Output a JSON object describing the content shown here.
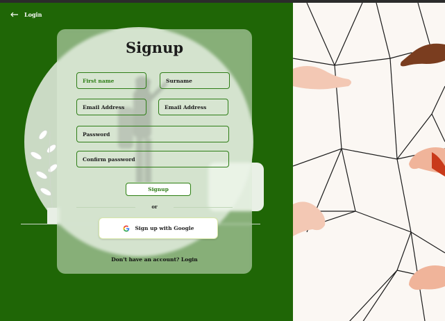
{
  "nav": {
    "back_label": "Login"
  },
  "form": {
    "title": "Signup",
    "first_name_placeholder": "First name",
    "surname_placeholder": "Surname",
    "email_placeholder": "Email Address",
    "email2_placeholder": "Email Address",
    "password_placeholder": "Password",
    "confirm_password_placeholder": "Confirm password",
    "signup_label": "Signup",
    "or_label": "or",
    "google_label": "Sign up with Google",
    "footer_text": "Don't have an account? Login"
  },
  "colors": {
    "primary_green": "#1f6606",
    "accent_green": "#2e7d16",
    "panel_bg": "#fbf7f3"
  },
  "icons": {
    "back": "arrow-left-icon",
    "google": "google-icon"
  }
}
